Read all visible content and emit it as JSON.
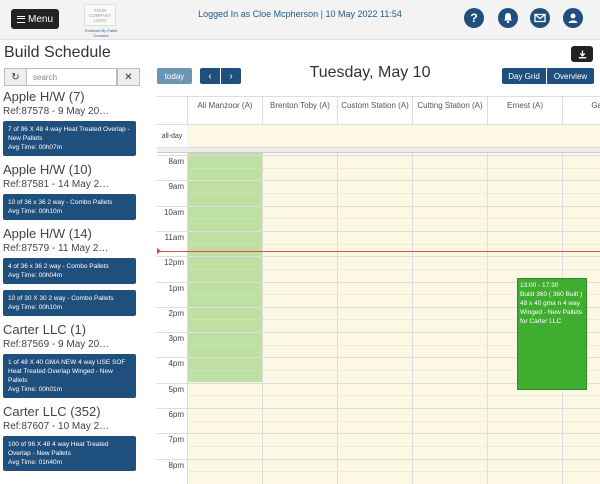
{
  "topbar": {
    "menu_label": "Menu",
    "logo_text": "YOUR COMPANY LOGO",
    "logo_sub": "Powered By Pallet Connect",
    "logged_in": "Logged In as Cloe Mcpherson | 10 May 2022 11:54",
    "icons": [
      "help-icon",
      "bell-icon",
      "mail-icon",
      "user-icon"
    ],
    "help_glyph": "?"
  },
  "page_title": "Build Schedule",
  "search": {
    "placeholder": "search"
  },
  "groups": [
    {
      "title": "Apple H/W (7)",
      "ref": "Ref:87578    -    9 May 20…",
      "tasks": [
        {
          "desc": "7 of 96 X 48 4 way Heat Treated Overlap - New Pallets",
          "avg": "Avg Time: 00h07m"
        }
      ]
    },
    {
      "title": "Apple H/W (10)",
      "ref": "Ref:87581    -    14 May 2…",
      "tasks": [
        {
          "desc": "10 of 36 x 36 2 way - Combo Pallets",
          "avg": "Avg Time: 00h10m"
        }
      ]
    },
    {
      "title": "Apple H/W (14)",
      "ref": "Ref:87579    -    11 May 2…",
      "tasks": [
        {
          "desc": "4 of 36 x 36 2 way - Combo Pallets",
          "avg": "Avg Time: 00h04m"
        },
        {
          "desc": "10 of 30 X 30 2 way - Combo Pallets",
          "avg": "Avg Time: 00h10m"
        }
      ]
    },
    {
      "title": "Carter LLC (1)",
      "ref": "Ref:87569    -    9 May 20…",
      "tasks": [
        {
          "desc": "1 of 48 X 40 GMA NEW 4 way USE SOF Heat Treated Overlap Winged - New Pallets",
          "avg": "Avg Time: 00h01m"
        }
      ]
    },
    {
      "title": "Carter LLC (352)",
      "ref": "Ref:87607    -    10 May 2…",
      "tasks": [
        {
          "desc": "100 of 96 X 48 4 way Heat Treated Overlap - New Pallets",
          "avg": "Avg Time: 01h40m"
        }
      ]
    }
  ],
  "calendar": {
    "today_label": "today",
    "prev_glyph": "‹",
    "next_glyph": "›",
    "title": "Tuesday, May 10",
    "view_day": "Day Grid",
    "view_overview": "Overview",
    "allday_label": "all-day",
    "columns": [
      "Ali Manzoor (A)",
      "Brenton Toby (A)",
      "Custom Station (A)",
      "Cutting Station (A)",
      "Ernest (A)",
      "Gary"
    ],
    "times": [
      "8am",
      "9am",
      "10am",
      "11am",
      "12pm",
      "1pm",
      "2pm",
      "3pm",
      "4pm",
      "5pm",
      "6pm",
      "7pm",
      "8pm"
    ],
    "event": {
      "time": "13:00 - 17:30",
      "title": "Build 360 ( 360 Built ) 48 x 40 gma n 4 way Winged - New Pallets for Carter LLC"
    }
  },
  "colors": {
    "brand": "#1f4f7d",
    "event_green": "#3fae30",
    "busy_green": "#bfe0a4",
    "slot_bg": "#fcf8e3",
    "now_line": "#e24d4d"
  }
}
